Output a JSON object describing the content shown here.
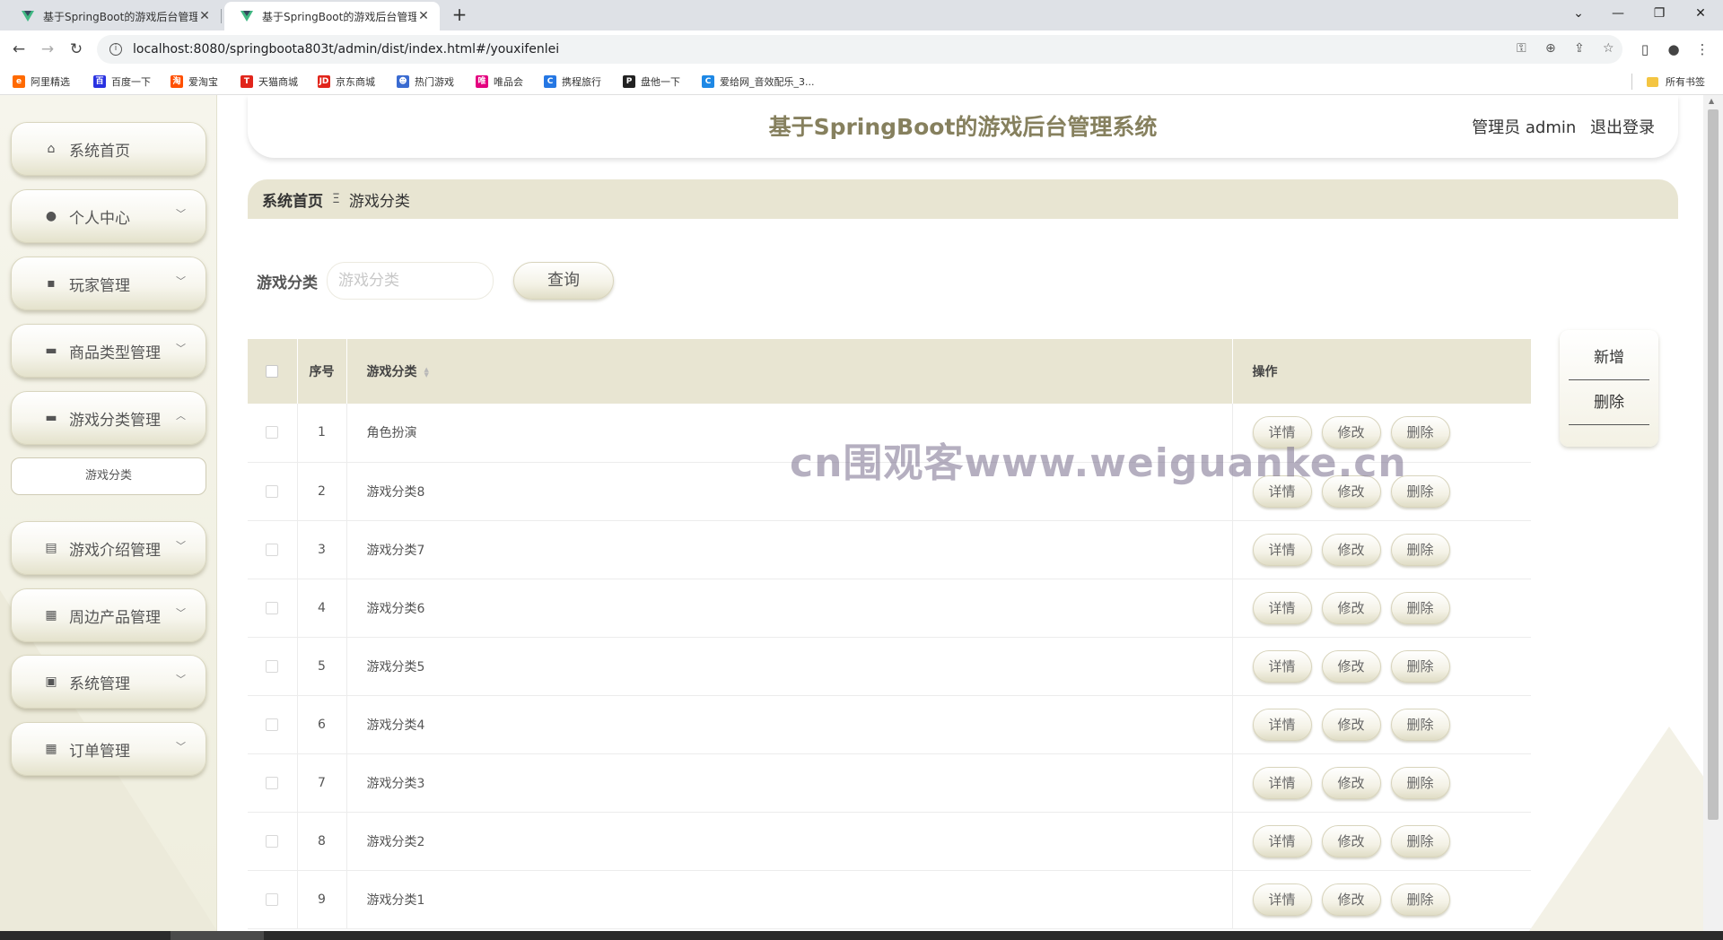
{
  "browser": {
    "tabs": [
      {
        "title": "基于SpringBoot的游戏后台管理",
        "active": false
      },
      {
        "title": "基于SpringBoot的游戏后台管理",
        "active": true
      }
    ],
    "url": "localhost:8080/springboota803t/admin/dist/index.html#/youxifenlei",
    "bookmarks": [
      {
        "label": "阿里精选",
        "icon": "alibaba-icon",
        "color": "#ff6a00"
      },
      {
        "label": "百度一下",
        "icon": "baidu-icon",
        "color": "#2932e1"
      },
      {
        "label": "爱淘宝",
        "icon": "taobao-icon",
        "color": "#ff5000"
      },
      {
        "label": "天猫商城",
        "icon": "tmall-icon",
        "color": "#e1251b"
      },
      {
        "label": "京东商城",
        "icon": "jd-icon",
        "color": "#e1251b"
      },
      {
        "label": "热门游戏",
        "icon": "game-icon",
        "color": "#3a6bd1"
      },
      {
        "label": "唯品会",
        "icon": "vip-icon",
        "color": "#e4007f"
      },
      {
        "label": "携程旅行",
        "icon": "ctrip-icon",
        "color": "#2577e3"
      },
      {
        "label": "盘他一下",
        "icon": "pan-icon",
        "color": "#222222"
      },
      {
        "label": "爱给网_音效配乐_3...",
        "icon": "aigei-icon",
        "color": "#1e88e5"
      }
    ],
    "bookmarks_all": "所有书签"
  },
  "sidebar": {
    "items": [
      {
        "label": "系统首页",
        "icon": "home-icon",
        "has_arrow": false
      },
      {
        "label": "个人中心",
        "icon": "user-icon",
        "has_arrow": true
      },
      {
        "label": "玩家管理",
        "icon": "chat-icon",
        "has_arrow": true
      },
      {
        "label": "商品类型管理",
        "icon": "briefcase-icon",
        "has_arrow": true
      },
      {
        "label": "游戏分类管理",
        "icon": "monitor-icon",
        "has_arrow": true,
        "expanded": true
      },
      {
        "label": "游戏介绍管理",
        "icon": "clipboard-icon",
        "has_arrow": true
      },
      {
        "label": "周边产品管理",
        "icon": "grid-icon",
        "has_arrow": true
      },
      {
        "label": "系统管理",
        "icon": "settings-clipboard-icon",
        "has_arrow": true
      },
      {
        "label": "订单管理",
        "icon": "grid-icon",
        "has_arrow": true
      }
    ],
    "submenu": {
      "label": "游戏分类"
    }
  },
  "header": {
    "title": "基于SpringBoot的游戏后台管理系统",
    "user": "管理员 admin",
    "logout": "退出登录"
  },
  "breadcrumb": {
    "home": "系统首页",
    "separator": "Ξ",
    "current": "游戏分类"
  },
  "search": {
    "label": "游戏分类",
    "placeholder": "游戏分类",
    "value": "",
    "button": "查询"
  },
  "table": {
    "columns": {
      "index": "序号",
      "name": "游戏分类",
      "actions": "操作"
    },
    "rows": [
      {
        "index": "1",
        "name": "角色扮演"
      },
      {
        "index": "2",
        "name": "游戏分类8"
      },
      {
        "index": "3",
        "name": "游戏分类7"
      },
      {
        "index": "4",
        "name": "游戏分类6"
      },
      {
        "index": "5",
        "name": "游戏分类5"
      },
      {
        "index": "6",
        "name": "游戏分类4"
      },
      {
        "index": "7",
        "name": "游戏分类3"
      },
      {
        "index": "8",
        "name": "游戏分类2"
      },
      {
        "index": "9",
        "name": "游戏分类1"
      }
    ],
    "row_actions": {
      "detail": "详情",
      "edit": "修改",
      "delete": "删除"
    }
  },
  "side_actions": {
    "add": "新增",
    "delete": "删除"
  },
  "watermark": "cn围观客www.weiguanke.cn",
  "colors": {
    "accent": "#86805e",
    "header_bg": "#e8e5d2",
    "sidebar_bg": "#f6f5ec"
  }
}
